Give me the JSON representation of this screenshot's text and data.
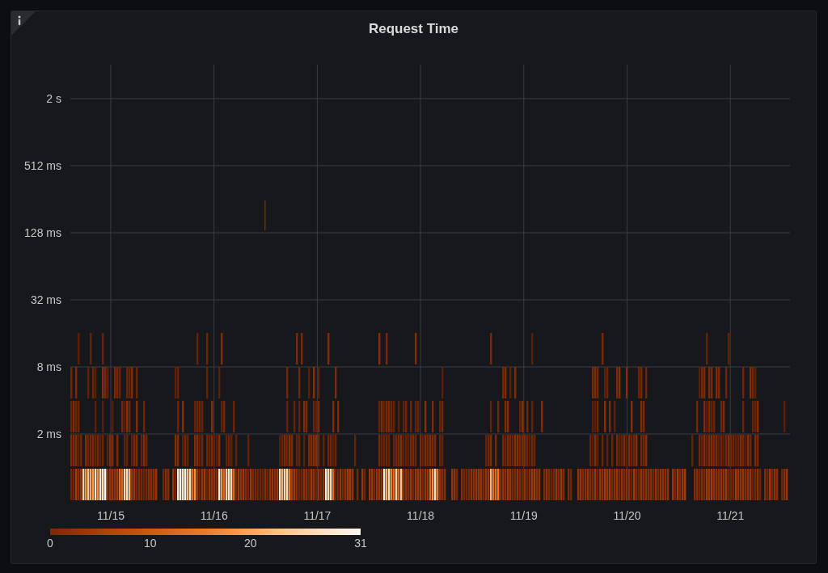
{
  "panel": {
    "title": "Request Time"
  },
  "y_axis": {
    "ticks": [
      "2 s",
      "512 ms",
      "128 ms",
      "32 ms",
      "8 ms",
      "2 ms"
    ]
  },
  "x_axis": {
    "ticks": [
      "11/15",
      "11/16",
      "11/17",
      "11/18",
      "11/19",
      "11/20",
      "11/21"
    ]
  },
  "legend": {
    "ticks": [
      "0",
      "10",
      "20",
      "31"
    ]
  }
}
